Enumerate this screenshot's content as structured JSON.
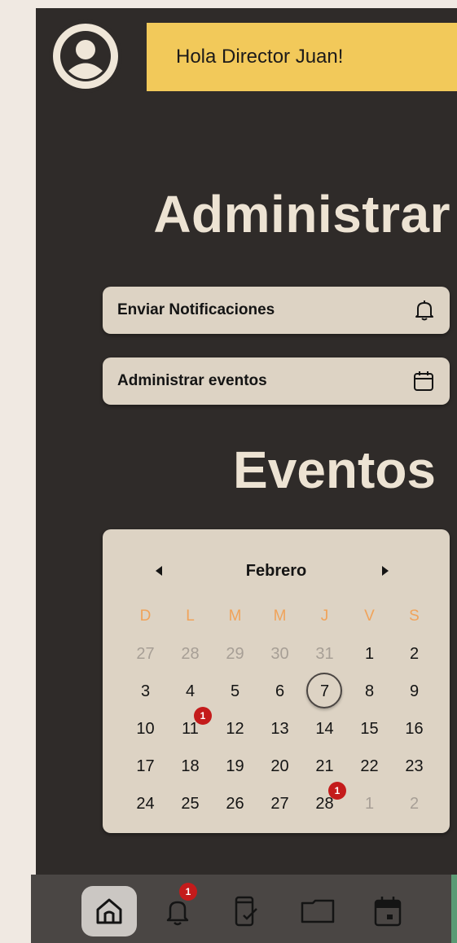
{
  "header": {
    "greeting": "Hola Director Juan!",
    "avatar_icon": "user-circle-icon"
  },
  "admin": {
    "title": "Administrar",
    "actions": [
      {
        "label": "Enviar Notificaciones",
        "icon": "bell-icon"
      },
      {
        "label": "Administrar eventos",
        "icon": "calendar-icon"
      }
    ]
  },
  "events": {
    "title": "Eventos",
    "calendar": {
      "month": "Febrero",
      "prev_icon": "caret-left-icon",
      "next_icon": "caret-right-icon",
      "weekdays": [
        "D",
        "L",
        "M",
        "M",
        "J",
        "V",
        "S"
      ],
      "weeks": [
        [
          "27",
          "28",
          "29",
          "30",
          "31",
          "1",
          "2"
        ],
        [
          "3",
          "4",
          "5",
          "6",
          "7",
          "8",
          "9"
        ],
        [
          "10",
          "11",
          "12",
          "13",
          "14",
          "15",
          "16"
        ],
        [
          "17",
          "18",
          "19",
          "20",
          "21",
          "22",
          "23"
        ],
        [
          "24",
          "25",
          "26",
          "27",
          "28",
          "1",
          "2"
        ]
      ],
      "today": "7",
      "event_badges": {
        "11": "1",
        "28": "1"
      }
    }
  },
  "bottom_nav": {
    "items": [
      {
        "icon": "home-icon",
        "active": true
      },
      {
        "icon": "bell-icon",
        "badge": "1"
      },
      {
        "icon": "phone-check-icon"
      },
      {
        "icon": "folder-icon"
      },
      {
        "icon": "calendar-icon"
      }
    ]
  },
  "colors": {
    "background": "#2f2b29",
    "greeting_bg": "#f2c95a",
    "card_bg": "#ddd3c4",
    "heading": "#ede3d3",
    "weekday": "#f0a35a",
    "badge": "#c41b1b"
  }
}
